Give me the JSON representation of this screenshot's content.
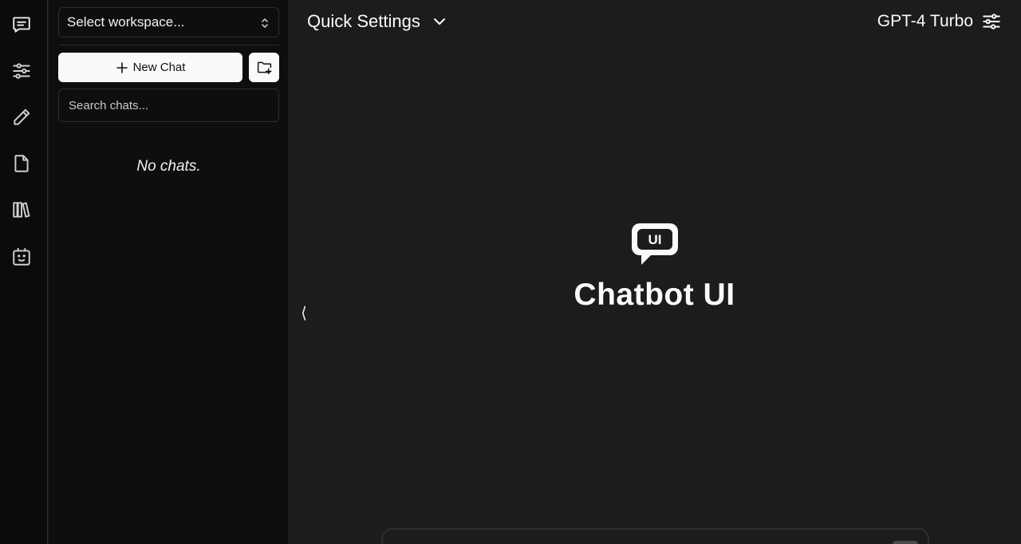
{
  "rail": {
    "items": [
      {
        "icon": "message-square-icon"
      },
      {
        "icon": "sliders-icon"
      },
      {
        "icon": "pencil-icon"
      },
      {
        "icon": "file-icon"
      },
      {
        "icon": "books-icon"
      },
      {
        "icon": "robot-icon"
      }
    ]
  },
  "sidebar": {
    "workspace_select": "Select workspace...",
    "new_chat_label": "New Chat",
    "search_placeholder": "Search chats...",
    "empty_text": "No chats."
  },
  "header": {
    "quick_settings_label": "Quick Settings",
    "model_label": "GPT-4 Turbo"
  },
  "main": {
    "collapse_glyph": "⟨",
    "logo_text": "UI",
    "brand_title": "Chatbot UI"
  },
  "colors": {
    "rail_bg": "#0b0b0b",
    "sidebar_bg": "#0e0e0e",
    "main_bg": "#1c1c1c",
    "button_bg": "#fafafa"
  }
}
